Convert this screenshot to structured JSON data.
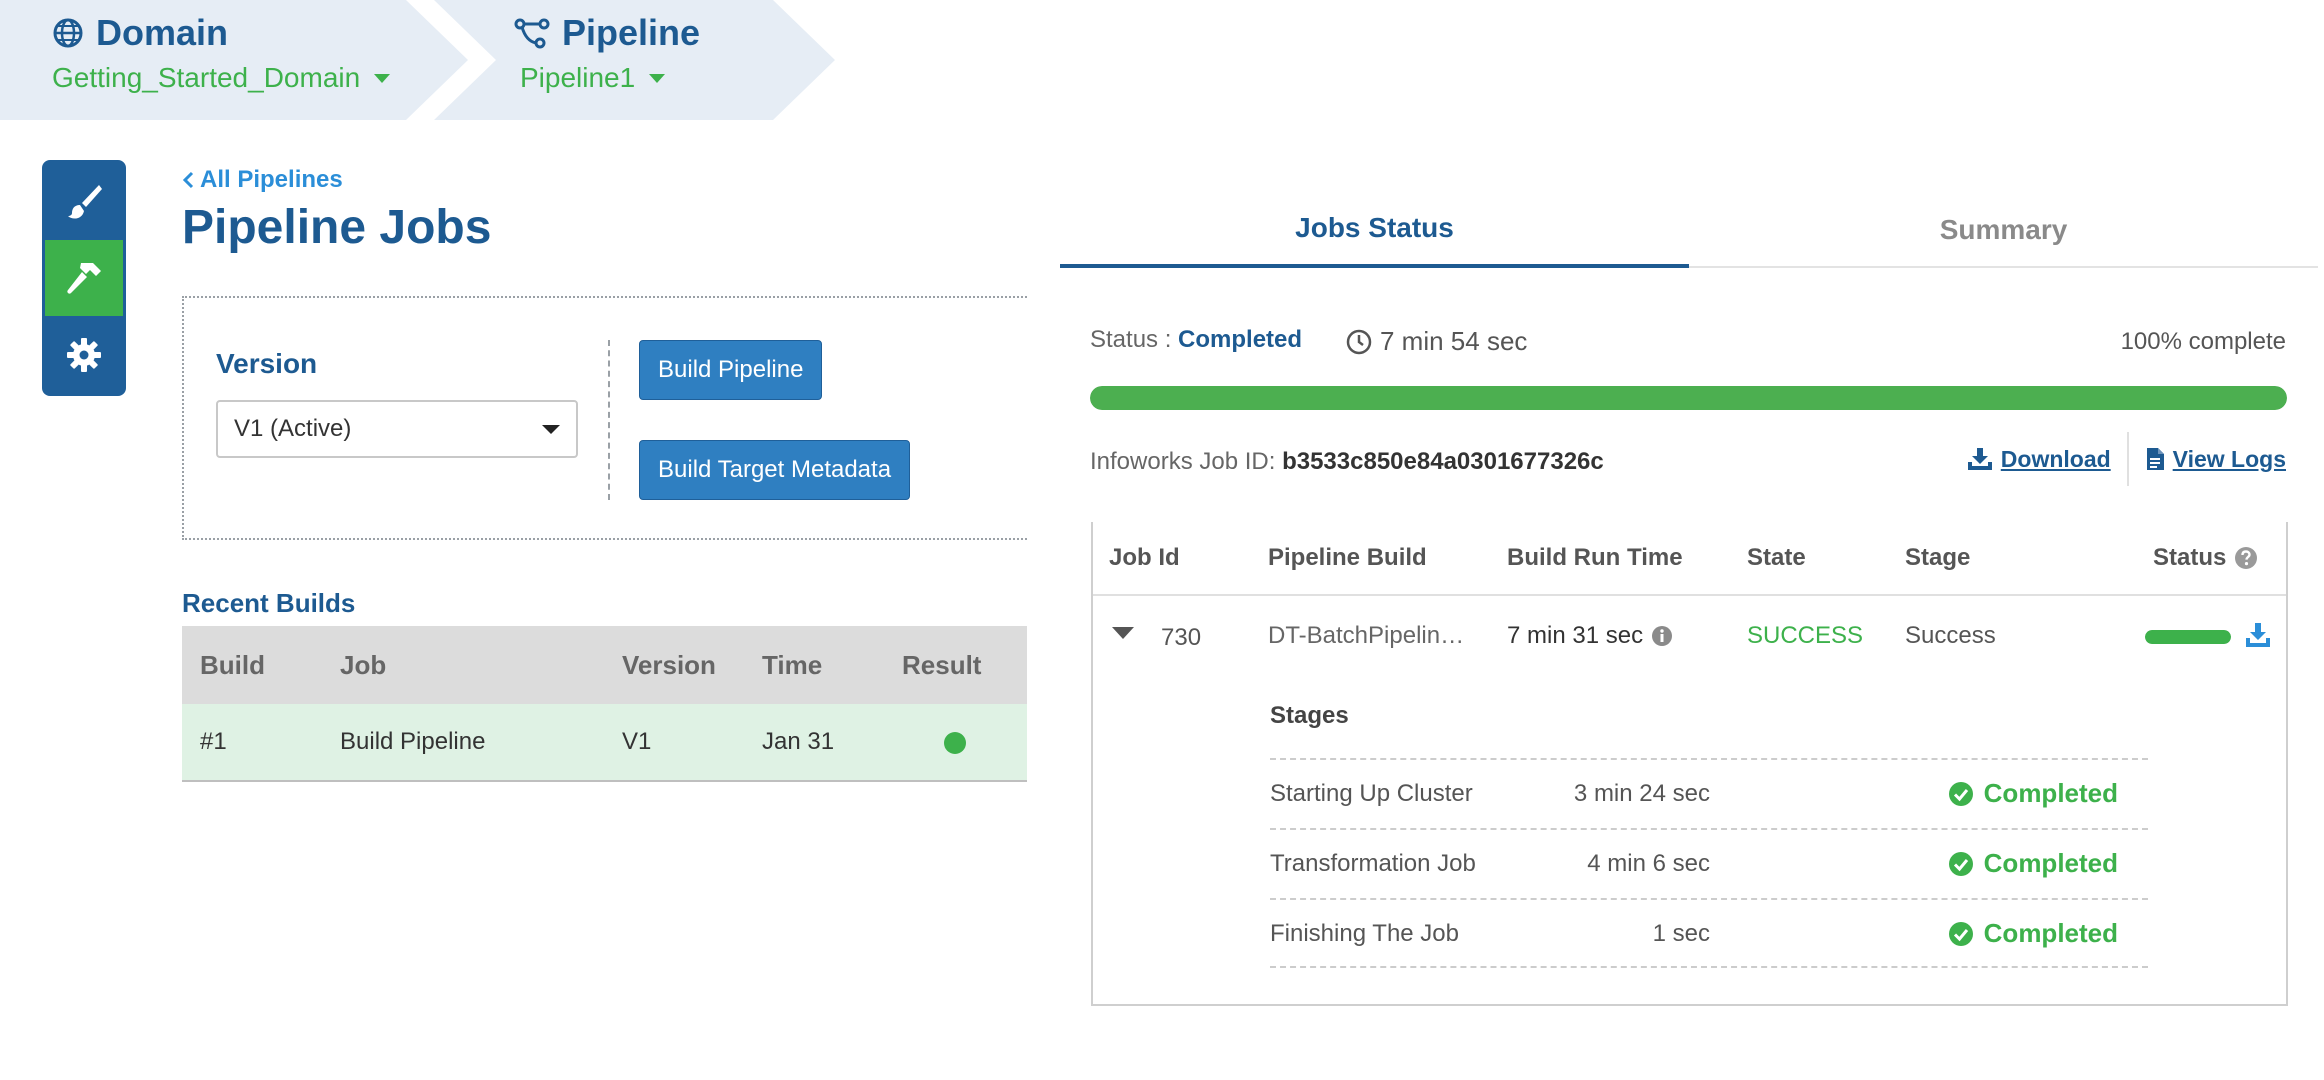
{
  "breadcrumb": {
    "domain_title": "Domain",
    "domain_value": "Getting_Started_Domain",
    "pipeline_title": "Pipeline",
    "pipeline_value": "Pipeline1"
  },
  "sidebar": {
    "items": [
      {
        "icon": "paintbrush-icon",
        "active": false
      },
      {
        "icon": "hammer-icon",
        "active": true
      },
      {
        "icon": "gear-icon",
        "active": false
      }
    ]
  },
  "left": {
    "back_link": "All Pipelines",
    "page_title": "Pipeline Jobs",
    "version_label": "Version",
    "version_selected": "V1 (Active)",
    "build_pipeline_label": "Build Pipeline",
    "build_metadata_label": "Build Target Metadata",
    "recent_title": "Recent Builds",
    "recent_columns": [
      "Build",
      "Job",
      "Version",
      "Time",
      "Result"
    ],
    "recent_rows": [
      {
        "build": "#1",
        "job": "Build Pipeline",
        "version": "V1",
        "time": "Jan 31",
        "result": "success"
      }
    ]
  },
  "right": {
    "tabs": [
      "Jobs Status",
      "Summary"
    ],
    "active_tab": "Jobs Status",
    "status_label": "Status :",
    "status_value": "Completed",
    "duration": "7 min 54 sec",
    "percent_text": "100% complete",
    "progress": 1.0,
    "job_id_label": "Infoworks Job ID:",
    "job_id_value": "b3533c850e84a0301677326c",
    "download_label": "Download",
    "view_logs_label": "View Logs",
    "table_columns": [
      "Job Id",
      "Pipeline Build",
      "Build Run Time",
      "State",
      "Stage",
      "Status"
    ],
    "job": {
      "id": "730",
      "pipeline_build": "DT-BatchPipelin…",
      "run_time": "7 min 31 sec",
      "state": "SUCCESS",
      "stage": "Success",
      "status_progress": 1.0
    },
    "stages_title": "Stages",
    "stages": [
      {
        "name": "Starting Up Cluster",
        "time": "3 min 24 sec",
        "status": "Completed"
      },
      {
        "name": "Transformation Job",
        "time": "4 min 6 sec",
        "status": "Completed"
      },
      {
        "name": "Finishing The Job",
        "time": "1 sec",
        "status": "Completed"
      }
    ]
  },
  "colors": {
    "brand_blue": "#1d5a91",
    "success_green": "#3db14b",
    "button_blue": "#2f7fc1",
    "breadcrumb_bg": "#e6edf5"
  }
}
